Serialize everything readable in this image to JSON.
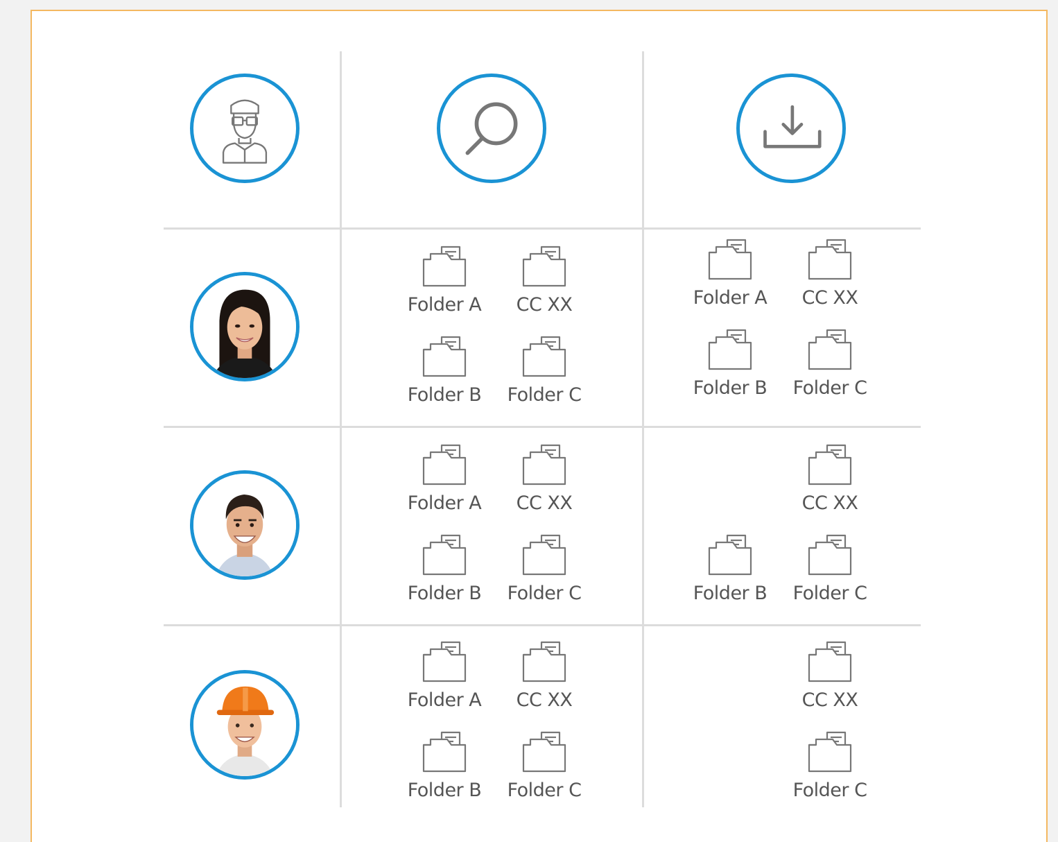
{
  "colors": {
    "accent": "#1a93d4",
    "frame": "#f4b860",
    "grid": "#dcdcdc",
    "icon": "#777777",
    "text": "#555555"
  },
  "header": {
    "icons": [
      {
        "name": "user-icon"
      },
      {
        "name": "search-icon"
      },
      {
        "name": "download-icon"
      }
    ]
  },
  "rows": [
    {
      "avatar": "avatar-woman",
      "view": [
        "Folder A",
        "CC XX",
        "Folder B",
        "Folder C"
      ],
      "download": [
        "Folder A",
        "CC XX",
        "Folder B",
        "Folder C"
      ]
    },
    {
      "avatar": "avatar-man",
      "view": [
        "Folder A",
        "CC XX",
        "Folder B",
        "Folder C"
      ],
      "download": [
        "",
        "CC XX",
        "Folder B",
        "Folder C"
      ]
    },
    {
      "avatar": "avatar-worker-hardhat",
      "view": [
        "Folder A",
        "CC XX",
        "Folder B",
        "Folder C"
      ],
      "download": [
        "",
        "CC XX",
        "",
        "Folder C"
      ]
    }
  ]
}
